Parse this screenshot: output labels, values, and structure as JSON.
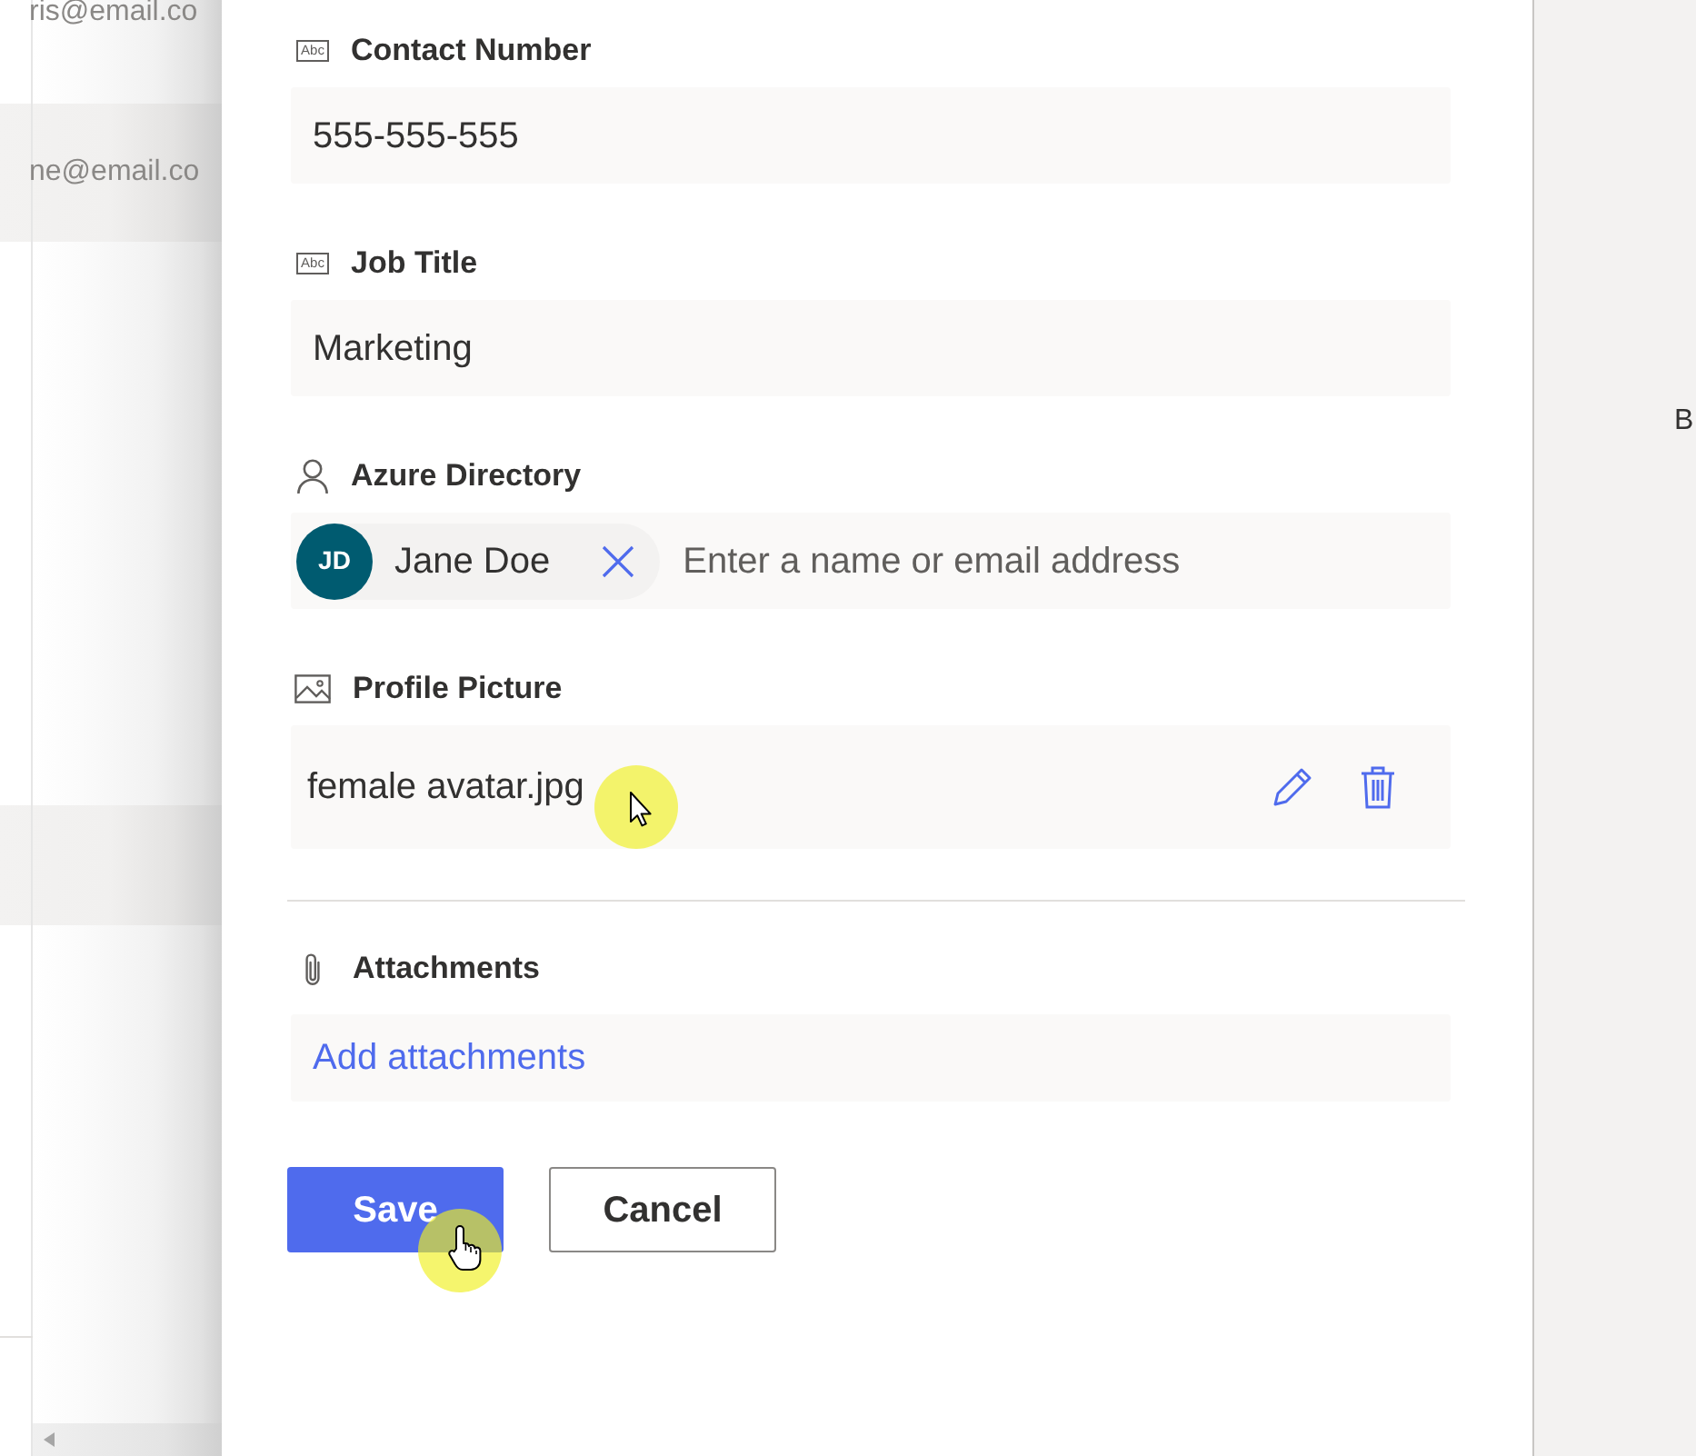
{
  "background_list": {
    "rows": [
      {
        "email": "ris@email.co",
        "highlighted": false
      },
      {
        "email": "ne@email.co",
        "highlighted": true
      },
      {
        "highlighted": true
      }
    ]
  },
  "form": {
    "fields": [
      {
        "kind": "text",
        "icon_label": "Abc",
        "label": "Contact Number",
        "value": "555-555-555",
        "hovered": false
      },
      {
        "kind": "text",
        "icon_label": "Abc",
        "label": "Job Title",
        "value": "Marketing",
        "hovered": false
      },
      {
        "kind": "people",
        "label": "Azure Directory",
        "people": [
          {
            "initials": "JD",
            "name": "Jane Doe"
          }
        ],
        "placeholder": "Enter a name or email address",
        "hovered": false
      },
      {
        "kind": "image",
        "label": "Profile Picture",
        "file_name": "female avatar.jpg",
        "hovered": true
      }
    ],
    "attachments": {
      "label": "Attachments",
      "link": "Add attachments"
    },
    "buttons": [
      {
        "kind": "primary",
        "label": "Save",
        "hovered": true
      },
      {
        "kind": "secondary",
        "label": "Cancel",
        "hovered": false
      }
    ]
  },
  "right_pane": {
    "text": "B"
  }
}
